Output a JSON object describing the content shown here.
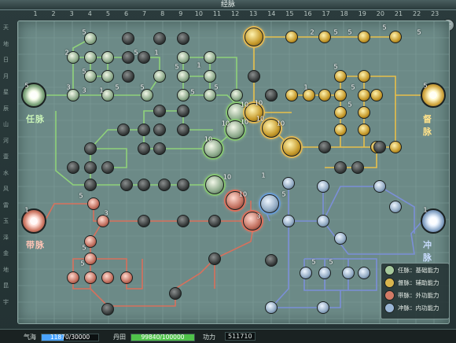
{
  "window": {
    "title": "经脉",
    "close_glyph": "✕"
  },
  "column_numbers": [
    "1",
    "2",
    "3",
    "4",
    "5",
    "6",
    "7",
    "8",
    "9",
    "10",
    "11",
    "12",
    "13",
    "14",
    "15",
    "16",
    "17",
    "18",
    "19",
    "20",
    "21",
    "22",
    "23"
  ],
  "row_labels": [
    "天",
    "地",
    "日",
    "月",
    "星",
    "辰",
    "山",
    "河",
    "壹",
    "水",
    "风",
    "雷",
    "玉",
    "泽",
    "金",
    "地",
    "昆",
    "宇"
  ],
  "hubs": {
    "ren": {
      "label": "任脉",
      "level": "5",
      "color": "green"
    },
    "du": {
      "label": "督脉",
      "level": "5",
      "color": "gold"
    },
    "dai": {
      "label": "带脉",
      "level": "1",
      "color": "red"
    },
    "chong": {
      "label": "冲脉",
      "level": "1",
      "color": "blue"
    }
  },
  "legend": [
    {
      "label": "任脉：基础能力",
      "color": "#a6c99c"
    },
    {
      "label": "督脉：辅助能力",
      "color": "#d9b54e"
    },
    {
      "label": "带脉：外功能力",
      "color": "#d27a66"
    },
    {
      "label": "冲脉：内功能力",
      "color": "#9ab6d6"
    }
  ],
  "status": {
    "qihai_label": "气海",
    "qihai_value": "11870/30000",
    "qihai_fraction": 0.3957,
    "qihai_color": "#4aa3ff",
    "dantian_label": "丹田",
    "dantian_value": "99840/100000",
    "dantian_fraction": 0.9984,
    "dantian_color": "#4fc24a",
    "gongli_label": "功力",
    "gongli_value": "511710"
  },
  "level_badges": [
    "5",
    "2",
    "5",
    "5",
    "1",
    "5",
    "5",
    "5",
    "3",
    "3",
    "1",
    "1",
    "5",
    "5",
    "2",
    "5",
    "5",
    "5",
    "5",
    "5",
    "5",
    "1",
    "5",
    "10",
    "10",
    "10",
    "10",
    "10",
    "10",
    "10",
    "10",
    "10",
    "1",
    "5",
    "3",
    "5",
    "3",
    "5",
    "5",
    "5",
    "5"
  ],
  "path_colors": {
    "green": "#8fd27a",
    "gold": "#e8c04a",
    "red": "#d8705c",
    "blue": "#7b8fd8"
  }
}
